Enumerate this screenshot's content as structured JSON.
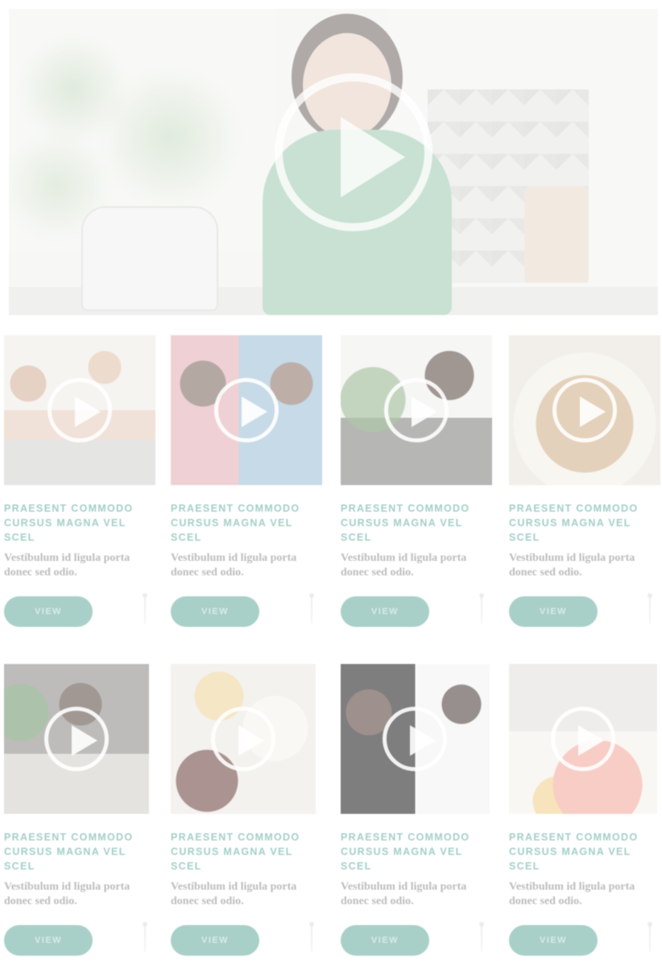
{
  "hero": {
    "play_icon": "play-circle-icon"
  },
  "cards": [
    {
      "title": "PRAESENT COMMODO CURSUS MAGNA VEL SCEL",
      "description": "Vestibulum id ligula porta donec sed odio.",
      "button": "VIEW",
      "play_icon": "play-circle-icon",
      "more_icon": "more-icon"
    },
    {
      "title": "PRAESENT COMMODO CURSUS MAGNA VEL SCEL",
      "description": "Vestibulum id ligula porta donec sed odio.",
      "button": "VIEW",
      "play_icon": "play-circle-icon",
      "more_icon": "more-icon"
    },
    {
      "title": "PRAESENT COMMODO CURSUS MAGNA VEL SCEL",
      "description": "Vestibulum id ligula porta donec sed odio.",
      "button": "VIEW",
      "play_icon": "play-circle-icon",
      "more_icon": "more-icon"
    },
    {
      "title": "PRAESENT COMMODO CURSUS MAGNA VEL SCEL",
      "description": "Vestibulum id ligula porta donec sed odio.",
      "button": "VIEW",
      "play_icon": "play-circle-icon",
      "more_icon": "more-icon"
    },
    {
      "title": "PRAESENT COMMODO CURSUS MAGNA VEL SCEL",
      "description": "Vestibulum id ligula porta donec sed odio.",
      "button": "VIEW",
      "play_icon": "play-circle-icon",
      "more_icon": "more-icon"
    },
    {
      "title": "PRAESENT COMMODO CURSUS MAGNA VEL SCEL",
      "description": "Vestibulum id ligula porta donec sed odio.",
      "button": "VIEW",
      "play_icon": "play-circle-icon",
      "more_icon": "more-icon"
    },
    {
      "title": "PRAESENT COMMODO CURSUS MAGNA VEL SCEL",
      "description": "Vestibulum id ligula porta donec sed odio.",
      "button": "VIEW",
      "play_icon": "play-circle-icon",
      "more_icon": "more-icon"
    },
    {
      "title": "PRAESENT COMMODO CURSUS MAGNA VEL SCEL",
      "description": "Vestibulum id ligula porta donec sed odio.",
      "button": "VIEW",
      "play_icon": "play-circle-icon",
      "more_icon": "more-icon"
    }
  ],
  "colors": {
    "accent": "#a9d0c8",
    "title_text": "#a3cfc7",
    "body_text": "#bdbdbd"
  }
}
